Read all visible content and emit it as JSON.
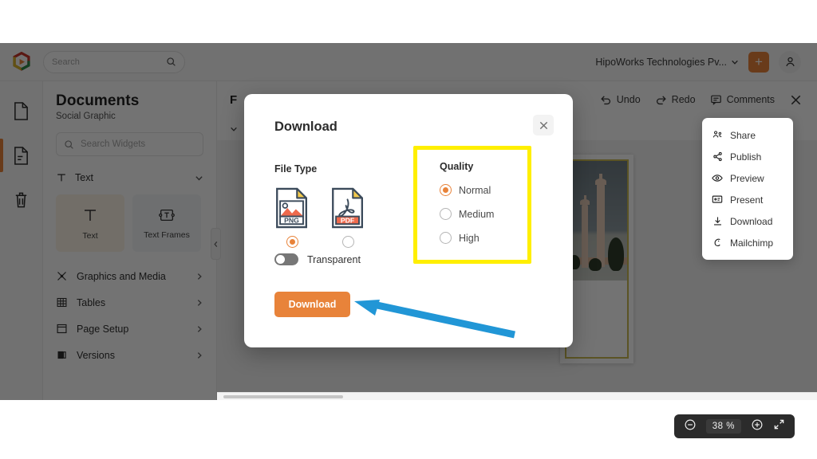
{
  "topbar": {
    "logo_icon": "zoho-logo-icon",
    "search": {
      "placeholder": "Search",
      "icon": "search-icon"
    },
    "org_name": "HipoWorks Technologies Pv...",
    "org_chevron_icon": "chevron-down-icon",
    "add_button_label": "+",
    "avatar_icon": "user-avatar-icon"
  },
  "rail": {
    "items": [
      {
        "name": "documents",
        "icon": "file-icon"
      },
      {
        "name": "pages",
        "icon": "file-lines-icon"
      },
      {
        "name": "trash",
        "icon": "trash-icon"
      }
    ]
  },
  "panel": {
    "title": "Documents",
    "subtitle": "Social Graphic",
    "search": {
      "placeholder": "Search Widgets",
      "icon": "search-icon"
    },
    "group": {
      "label": "Text",
      "icon": "text-t-icon",
      "chevron": "chevron-down-icon"
    },
    "tiles": [
      {
        "label": "Text",
        "icon": "text-t-icon"
      },
      {
        "label": "Text Frames",
        "icon": "text-frame-icon"
      }
    ],
    "menu": [
      {
        "label": "Graphics and Media",
        "icon": "graphics-media-icon"
      },
      {
        "label": "Tables",
        "icon": "table-icon"
      },
      {
        "label": "Page Setup",
        "icon": "page-setup-icon"
      },
      {
        "label": "Versions",
        "icon": "versions-icon"
      }
    ],
    "collapse_icon": "chevron-left-icon"
  },
  "editor": {
    "doc_title": "F",
    "tools": [
      {
        "label": "Undo",
        "icon": "undo-icon"
      },
      {
        "label": "Redo",
        "icon": "redo-icon"
      },
      {
        "label": "Comments",
        "icon": "comment-icon"
      }
    ],
    "close_icon": "close-icon",
    "zoom": {
      "value": "38",
      "unit": "%",
      "minus_icon": "zoom-out-icon",
      "plus_icon": "zoom-in-icon",
      "fullscreen_icon": "fullscreen-icon"
    }
  },
  "context_menu": {
    "items": [
      {
        "label": "Share",
        "icon": "share-users-icon"
      },
      {
        "label": "Publish",
        "icon": "publish-share-icon"
      },
      {
        "label": "Preview",
        "icon": "eye-icon"
      },
      {
        "label": "Present",
        "icon": "present-screen-icon"
      },
      {
        "label": "Download",
        "icon": "download-icon"
      },
      {
        "label": "Mailchimp",
        "icon": "mailchimp-icon"
      }
    ]
  },
  "modal": {
    "title": "Download",
    "close_icon": "close-icon",
    "file_type": {
      "label": "File Type",
      "options": [
        {
          "label": "PNG",
          "icon": "png-file-icon",
          "selected": true
        },
        {
          "label": "PDF",
          "icon": "pdf-file-icon",
          "selected": false
        }
      ]
    },
    "transparent": {
      "label": "Transparent",
      "enabled": false
    },
    "download_button": "Download",
    "quality": {
      "label": "Quality",
      "options": [
        {
          "label": "Normal",
          "selected": true
        },
        {
          "label": "Medium",
          "selected": false
        },
        {
          "label": "High",
          "selected": false
        }
      ],
      "highlight_color": "#ffef00"
    }
  },
  "annotation": {
    "arrow_color": "#2196d6",
    "arrow_name": "pointer-arrow"
  },
  "colors": {
    "accent": "#e8833a",
    "highlight": "#ffef00",
    "arrow": "#2196d6"
  }
}
